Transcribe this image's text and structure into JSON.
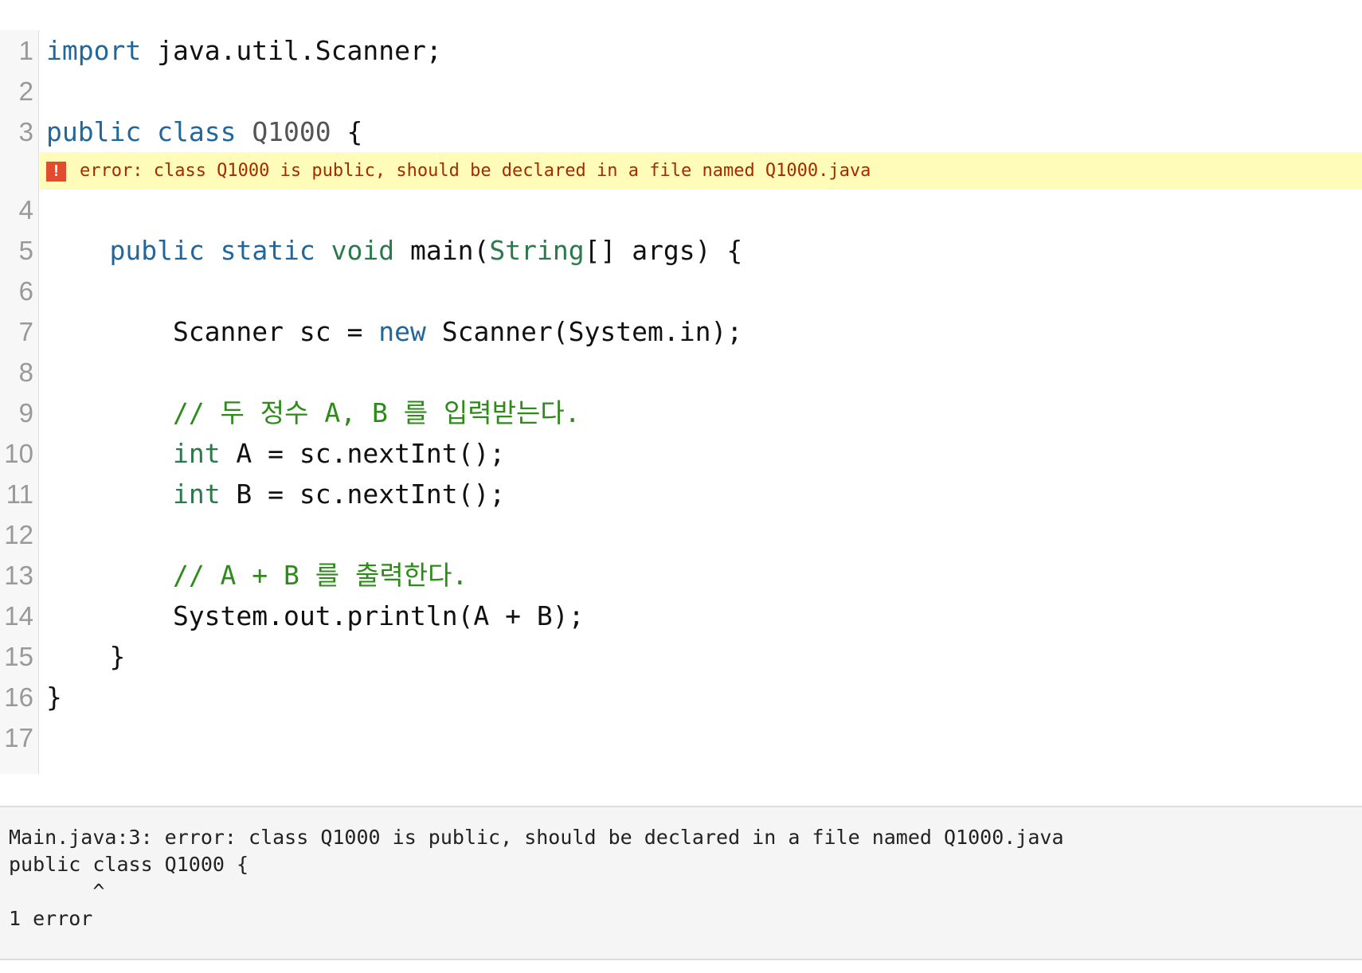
{
  "editor": {
    "lines": [
      {
        "n": "1",
        "tokens": [
          {
            "t": "import",
            "c": "kw"
          },
          {
            "t": " java.util.Scanner;",
            "c": ""
          }
        ]
      },
      {
        "n": "2",
        "tokens": []
      },
      {
        "n": "3",
        "tokens": [
          {
            "t": "public",
            "c": "kw"
          },
          {
            "t": " ",
            "c": ""
          },
          {
            "t": "class",
            "c": "kw"
          },
          {
            "t": " ",
            "c": ""
          },
          {
            "t": "Q1000",
            "c": "cls"
          },
          {
            "t": " {",
            "c": ""
          }
        ]
      },
      {
        "n": "4",
        "tokens": []
      },
      {
        "n": "5",
        "tokens": [
          {
            "t": "    ",
            "c": ""
          },
          {
            "t": "public",
            "c": "kw"
          },
          {
            "t": " ",
            "c": ""
          },
          {
            "t": "static",
            "c": "kw"
          },
          {
            "t": " ",
            "c": ""
          },
          {
            "t": "void",
            "c": "ty"
          },
          {
            "t": " main(",
            "c": ""
          },
          {
            "t": "String",
            "c": "ty"
          },
          {
            "t": "[] args) {",
            "c": ""
          }
        ]
      },
      {
        "n": "6",
        "tokens": []
      },
      {
        "n": "7",
        "tokens": [
          {
            "t": "        Scanner sc = ",
            "c": ""
          },
          {
            "t": "new",
            "c": "kw"
          },
          {
            "t": " Scanner(System.in);",
            "c": ""
          }
        ]
      },
      {
        "n": "8",
        "tokens": []
      },
      {
        "n": "9",
        "tokens": [
          {
            "t": "        ",
            "c": ""
          },
          {
            "t": "// 두 정수 A, B 를 입력받는다.",
            "c": "cm"
          }
        ]
      },
      {
        "n": "10",
        "tokens": [
          {
            "t": "        ",
            "c": ""
          },
          {
            "t": "int",
            "c": "ty"
          },
          {
            "t": " A = sc.nextInt();",
            "c": ""
          }
        ]
      },
      {
        "n": "11",
        "tokens": [
          {
            "t": "        ",
            "c": ""
          },
          {
            "t": "int",
            "c": "ty"
          },
          {
            "t": " B = sc.nextInt();",
            "c": ""
          }
        ]
      },
      {
        "n": "12",
        "tokens": []
      },
      {
        "n": "13",
        "tokens": [
          {
            "t": "        ",
            "c": ""
          },
          {
            "t": "// A + B 를 출력한다.",
            "c": "cm"
          }
        ]
      },
      {
        "n": "14",
        "tokens": [
          {
            "t": "        System.out.println(A + B);",
            "c": ""
          }
        ]
      },
      {
        "n": "15",
        "tokens": [
          {
            "t": "    }",
            "c": ""
          }
        ]
      },
      {
        "n": "16",
        "tokens": [
          {
            "t": "}",
            "c": ""
          }
        ]
      },
      {
        "n": "17",
        "tokens": []
      }
    ],
    "error_after_line": "3",
    "error_icon": "!",
    "error_message": "error: class Q1000 is public, should be declared in a file named Q1000.java"
  },
  "console": {
    "lines": [
      "Main.java:3: error: class Q1000 is public, should be declared in a file named Q1000.java",
      "public class Q1000 {",
      "       ^",
      "1 error"
    ]
  },
  "colors": {
    "keyword": "#22679b",
    "type": "#2b7a4b",
    "comment": "#2f8a1c",
    "error_bg": "#fffbb8",
    "error_icon": "#e34b2e"
  }
}
